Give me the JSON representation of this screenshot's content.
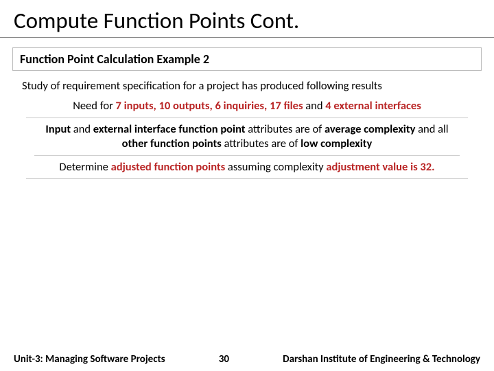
{
  "title": "Compute Function Points Cont.",
  "section_title": "Function Point Calculation Example 2",
  "line1": "Study of requirement specification for a project has produced following results",
  "line2": {
    "pre": "Need for ",
    "r1": "7 inputs,",
    "sp1": " ",
    "r2": "10 outputs,",
    "sp2": " ",
    "r3": "6 inquiries,",
    "sp3": " ",
    "r4": "17 files",
    "mid": " and ",
    "r5": "4 external interfaces"
  },
  "line3": {
    "b1": "Input",
    "t1": " and ",
    "b2": "external interface function point",
    "t2": " attributes are of ",
    "b3": "average complexity",
    "t3": " and all ",
    "b4": "other function points",
    "t4": " attributes are of ",
    "b5": "low complexity"
  },
  "line4": {
    "t1": "Determine ",
    "r1": "adjusted function points",
    "t2": " assuming complexity ",
    "r2": "adjustment value is 32."
  },
  "footer": {
    "left": "Unit-3: Managing Software Projects",
    "page": "30",
    "right": "Darshan Institute of Engineering & Technology"
  }
}
